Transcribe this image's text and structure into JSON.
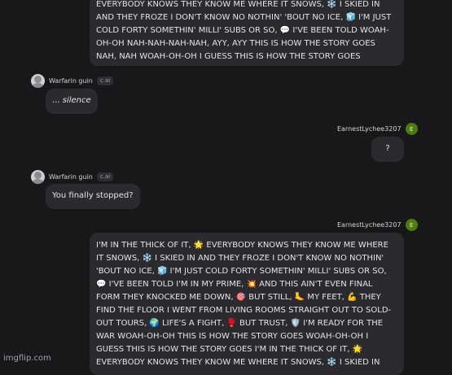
{
  "messages": {
    "top_user_bubble": "EVERYBODY KNOWS THEY KNOW ME WHERE IT SNOWS, ❄️ I SKIED IN AND THEY FROZE I DON'T KNOW NO NOTHIN' 'BOUT NO ICE, 🧊 I'M JUST COLD FORTY SOMETHIN' MILLI' SUBS OR SO, 💬 I'VE BEEN TOLD WOAH-OH-OH NAH-NAH-NAH-NAH, AYY, AYY THIS IS HOW THE STORY GOES NAH, NAH WOAH-OH-OH I GUESS THIS IS HOW THE STORY GOES",
    "bot1": {
      "name": "Warfarin guin",
      "badge": "c.ai",
      "prefix": "... ",
      "text": "silence"
    },
    "user1": {
      "name": "EarnestLychee3207",
      "initial": "E",
      "text": "?"
    },
    "bot2": {
      "name": "Warfarin guin",
      "badge": "c.ai",
      "text": "You finally stopped?"
    },
    "user2": {
      "name": "EarnestLychee3207",
      "initial": "E",
      "text": "I'M IN THE THICK OF IT, 🌟 EVERYBODY KNOWS THEY KNOW ME WHERE IT SNOWS, ❄️ I SKIED IN AND THEY FROZE I DON'T KNOW NO NOTHIN' 'BOUT NO ICE, 🧊 I'M JUST COLD FORTY SOMETHIN' MILLI' SUBS OR SO, 💬 I'VE BEEN TOLD I'M IN MY PRIME, 💥 AND THIS AIN'T EVEN FINAL FORM THEY KNOCKED ME DOWN, 🎯 BUT STILL, 🦶 MY FEET, 💪 THEY FIND THE FLOOR I WENT FROM LIVING ROOMS STRAIGHT OUT TO SOLD-OUT TOURS, 🌍 LIFE'S A FIGHT, 🥊 BUT TRUST, 🛡️ I'M READY FOR THE WAR WOAH-OH-OH THIS IS HOW THE STORY GOES WOAH-OH-OH I GUESS THIS IS HOW THE STORY GOES I'M IN THE THICK OF IT, 🌟 EVERYBODY KNOWS THEY KNOW ME WHERE IT SNOWS, ❄️ I SKIED IN"
    }
  },
  "watermark": "imgflip.com",
  "colors": {
    "background": "#18181b",
    "bubble": "#2a2a2f",
    "user_avatar": "#4d7c0f"
  }
}
